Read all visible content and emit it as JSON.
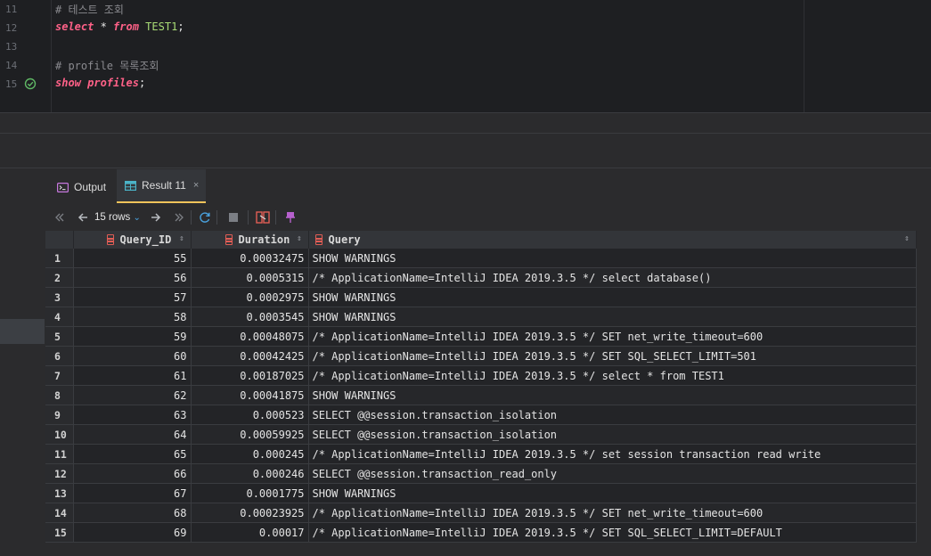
{
  "editor": {
    "lines": [
      {
        "num": "11",
        "text": "# 테스트 조회"
      },
      {
        "num": "12",
        "text": ""
      },
      {
        "num": "13",
        "text": ""
      },
      {
        "num": "14",
        "text": "# profile 목록조회"
      },
      {
        "num": "15",
        "text": ""
      }
    ],
    "line12_kw1": "select",
    "line12_star": " * ",
    "line12_kw2": "from",
    "line12_table": " TEST1",
    "line12_semi": ";",
    "line15_kw1": "show",
    "line15_kw2": " profiles",
    "line15_semi": ";"
  },
  "tabs": {
    "output_label": "Output",
    "result_label": "Result 11",
    "close_glyph": "×"
  },
  "toolbar": {
    "rows_label": "15 rows",
    "chevron": "⌄"
  },
  "grid": {
    "columns": [
      "Query_ID",
      "Duration",
      "Query"
    ],
    "rows": [
      {
        "n": "1",
        "id": "55",
        "dur": "0.00032475",
        "q": "SHOW WARNINGS"
      },
      {
        "n": "2",
        "id": "56",
        "dur": "0.0005315",
        "q": "/* ApplicationName=IntelliJ IDEA 2019.3.5 */ select database()"
      },
      {
        "n": "3",
        "id": "57",
        "dur": "0.0002975",
        "q": "SHOW WARNINGS"
      },
      {
        "n": "4",
        "id": "58",
        "dur": "0.0003545",
        "q": "SHOW WARNINGS"
      },
      {
        "n": "5",
        "id": "59",
        "dur": "0.00048075",
        "q": "/* ApplicationName=IntelliJ IDEA 2019.3.5 */ SET net_write_timeout=600"
      },
      {
        "n": "6",
        "id": "60",
        "dur": "0.00042425",
        "q": "/* ApplicationName=IntelliJ IDEA 2019.3.5 */ SET SQL_SELECT_LIMIT=501"
      },
      {
        "n": "7",
        "id": "61",
        "dur": "0.00187025",
        "q": "/* ApplicationName=IntelliJ IDEA 2019.3.5 */ select * from TEST1"
      },
      {
        "n": "8",
        "id": "62",
        "dur": "0.00041875",
        "q": "SHOW WARNINGS"
      },
      {
        "n": "9",
        "id": "63",
        "dur": "0.000523",
        "q": "SELECT @@session.transaction_isolation"
      },
      {
        "n": "10",
        "id": "64",
        "dur": "0.00059925",
        "q": "SELECT @@session.transaction_isolation"
      },
      {
        "n": "11",
        "id": "65",
        "dur": "0.000245",
        "q": "/* ApplicationName=IntelliJ IDEA 2019.3.5 */ set session transaction read write"
      },
      {
        "n": "12",
        "id": "66",
        "dur": "0.000246",
        "q": "SELECT @@session.transaction_read_only"
      },
      {
        "n": "13",
        "id": "67",
        "dur": "0.0001775",
        "q": "SHOW WARNINGS"
      },
      {
        "n": "14",
        "id": "68",
        "dur": "0.00023925",
        "q": "/* ApplicationName=IntelliJ IDEA 2019.3.5 */ SET net_write_timeout=600"
      },
      {
        "n": "15",
        "id": "69",
        "dur": "0.00017",
        "q": "/* ApplicationName=IntelliJ IDEA 2019.3.5 */ SET SQL_SELECT_LIMIT=DEFAULT"
      }
    ]
  },
  "colors": {
    "keyword": "#ff6188",
    "table": "#a9dc76",
    "accent_tab": "#f0c35a",
    "column_icon": "#e05d55"
  }
}
